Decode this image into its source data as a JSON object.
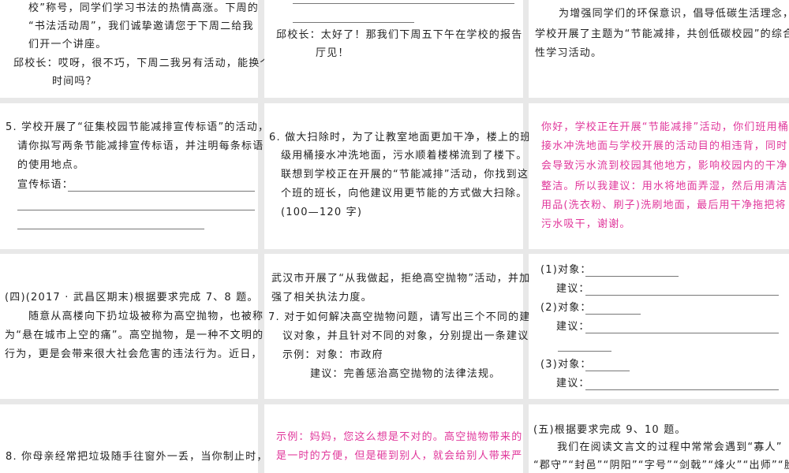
{
  "colors": {
    "text": "#222222",
    "answer": "#e0359a",
    "background": "#e8e8e8"
  },
  "r1c1": [
    "校”称号，同学们学习书法的热情高涨。下周的",
    "“书法活动周”，我们诚挚邀请您于下周二给我",
    "们开一个讲座。",
    "邱校长：哎呀，很不巧，下周二我另有活动，能换个",
    "时间吗？"
  ],
  "r1c2": [
    "邱校长：太好了！那我们下周五下午在学校的报告",
    "厅见！"
  ],
  "r1c3": [
    "为增强同学们的环保意识，倡导低碳生活理念，",
    "学校开展了主题为“节能减排，共创低碳校园”的综合",
    "性学习活动。"
  ],
  "r2c1": [
    "5. 学校开展了“征集校园节能减排宣传标语”的活动，",
    "请你拟写两条节能减排宣传标语，并注明每条标语",
    "的使用地点。",
    "宣传标语："
  ],
  "r2c2": [
    "6. 做大扫除时，为了让教室地面更加干净，楼上的班",
    "级用桶接水冲洗地面，污水顺着楼梯流到了楼下。",
    "联想到学校正在开展的“节能减排”活动，你找到这",
    "个班的班长，向他建议用更节能的方式做大扫除。",
    "(100—120 字)"
  ],
  "r2c3": [
    "你好，学校正在开展“节能减排”活动，你们班用桶",
    "接水冲洗地面与学校开展的活动目的相违背，同时",
    "会导致污水流到校园其他地方，影响校园内的干净",
    "整洁。所以我建议：用水将地面弄湿，然后用清洁",
    "用品(洗衣粉、刷子)洗刷地面，最后用干净拖把将",
    "污水吸干，谢谢。"
  ],
  "r3c1": [
    "(四)(2017 · 武昌区期末)根据要求完成 7、8 题。",
    "随意从高楼向下扔垃圾被称为高空抛物，也被称",
    "为“悬在城市上空的痛”。高空抛物，是一种不文明的",
    "行为，更是会带来很大社会危害的违法行为。近日，"
  ],
  "r3c2": [
    "武汉市开展了“从我做起，拒绝高空抛物”活动，并加",
    "强了相关执法力度。",
    "7. 对于如何解决高空抛物问题，请写出三个不同的建",
    "议对象，并且针对不同的对象，分别提出一条建议。",
    "示例：对象：市政府",
    "建议：完善惩治高空抛物的法律法规。"
  ],
  "r3c3": [
    "(1)对象：",
    "建议：",
    "(2)对象：",
    "建议：",
    "(3)对象：",
    "建议："
  ],
  "r4c1": [
    "8. 你母亲经常把垃圾随手往窗外一丢，当你制止时，"
  ],
  "r4c2": [
    "示例：妈妈，您这么想是不对的。高空抛物带来的",
    "是一时的方便，但是砸到别人，就会给别人带来严"
  ],
  "r4c3": [
    "(五)根据要求完成 9、10 题。",
    "我们在阅读文言文的过程中常常会遇到“寡人”",
    "“郡守”“封邑”“阴阳”“字号”“剑戟”“烽火”“出师”“脍"
  ]
}
